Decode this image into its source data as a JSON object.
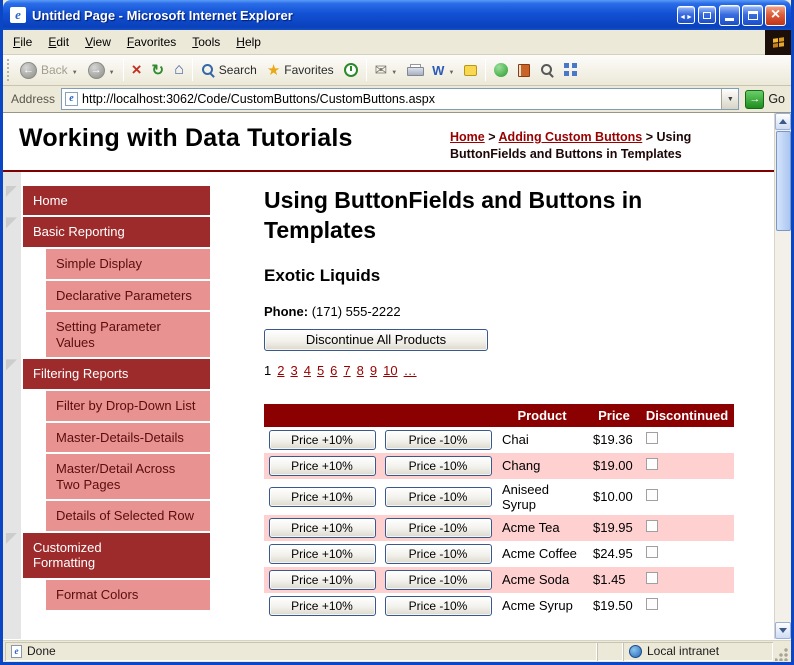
{
  "window": {
    "title": "Untitled Page - Microsoft Internet Explorer"
  },
  "menu_bar": {
    "items": [
      "File",
      "Edit",
      "View",
      "Favorites",
      "Tools",
      "Help"
    ]
  },
  "toolbar": {
    "back_label": "Back",
    "search_label": "Search",
    "favorites_label": "Favorites",
    "icons": [
      "back-icon",
      "forward-icon",
      "stop-icon",
      "refresh-icon",
      "home-icon",
      "search-icon",
      "favorites-icon",
      "history-icon",
      "mail-icon",
      "print-icon",
      "edit-word-icon",
      "discuss-icon",
      "messenger-icon",
      "research-icon",
      "find-icon",
      "links-grid-icon"
    ]
  },
  "address_bar": {
    "label": "Address",
    "url": "http://localhost:3062/Code/CustomButtons/CustomButtons.aspx",
    "go_label": "Go"
  },
  "page": {
    "site_title": "Working with Data Tutorials",
    "breadcrumb_separator": ">",
    "breadcrumb": [
      {
        "label": "Home",
        "link": true
      },
      {
        "label": "Adding Custom Buttons",
        "link": true
      },
      {
        "label": "Using ButtonFields and Buttons in Templates",
        "link": false
      }
    ],
    "sidebar": [
      {
        "label": "Home",
        "type": "section"
      },
      {
        "label": "Basic Reporting",
        "type": "section"
      },
      {
        "label": "Simple Display",
        "type": "sub"
      },
      {
        "label": "Declarative Parameters",
        "type": "sub"
      },
      {
        "label": "Setting Parameter Values",
        "type": "sub"
      },
      {
        "label": "Filtering Reports",
        "type": "section"
      },
      {
        "label": "Filter by Drop-Down List",
        "type": "sub"
      },
      {
        "label": "Master-Details-Details",
        "type": "sub"
      },
      {
        "label": "Master/Detail Across Two Pages",
        "type": "sub"
      },
      {
        "label": "Details of Selected Row",
        "type": "sub"
      },
      {
        "label": "Customized Formatting",
        "type": "section"
      },
      {
        "label": "Format Colors",
        "type": "sub"
      }
    ],
    "content": {
      "heading": "Using ButtonFields and Buttons in Templates",
      "supplier": "Exotic Liquids",
      "phone_label": "Phone:",
      "phone": "(171) 555-2222",
      "discontinue_all_label": "Discontinue All Products",
      "pager_current": "1",
      "pager_pages": [
        "2",
        "3",
        "4",
        "5",
        "6",
        "7",
        "8",
        "9",
        "10",
        "…"
      ],
      "grid": {
        "button_up_label": "Price +10%",
        "button_down_label": "Price -10%",
        "headers": [
          "Product",
          "Price",
          "Discontinued"
        ],
        "rows": [
          {
            "product": "Chai",
            "price": "$19.36",
            "discontinued": false
          },
          {
            "product": "Chang",
            "price": "$19.00",
            "discontinued": false
          },
          {
            "product": "Aniseed Syrup",
            "price": "$10.00",
            "discontinued": false
          },
          {
            "product": "Acme Tea",
            "price": "$19.95",
            "discontinued": false
          },
          {
            "product": "Acme Coffee",
            "price": "$24.95",
            "discontinued": false
          },
          {
            "product": "Acme Soda",
            "price": "$1.45",
            "discontinued": false
          },
          {
            "product": "Acme Syrup",
            "price": "$19.50",
            "discontinued": false
          }
        ]
      }
    }
  },
  "status_bar": {
    "left": "Done",
    "zone": "Local intranet"
  },
  "colors": {
    "titlebar_blue": "#1251d4",
    "maroon_link": "#990000",
    "table_header_bg": "#8b0000",
    "sidebar_section_bg": "#9e2b2b",
    "sidebar_sub_bg": "#e89292",
    "alt_row_bg": "#ffd0d0",
    "go_green": "#1e8c1e"
  }
}
